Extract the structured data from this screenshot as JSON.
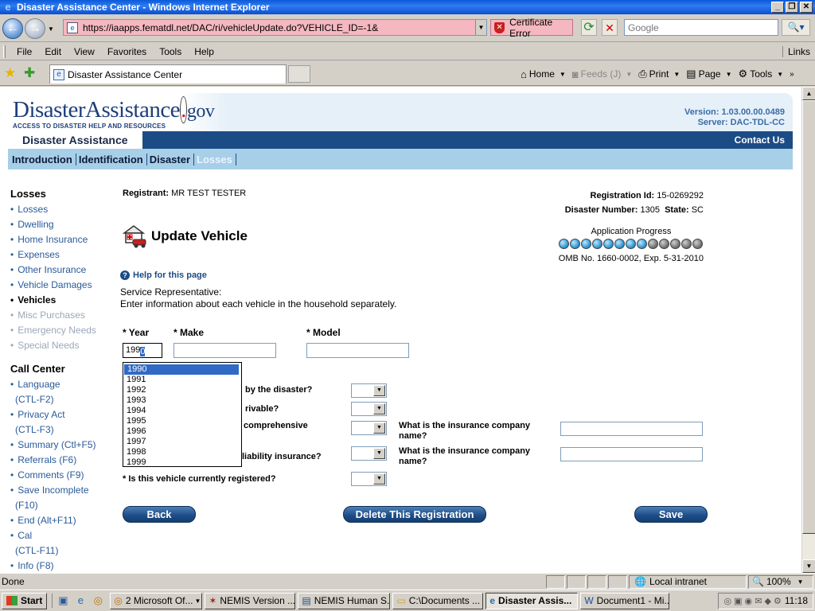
{
  "window": {
    "title": "Disaster Assistance Center - Windows Internet Explorer"
  },
  "address": {
    "url": "https://iaapps.fematdl.net/DAC/ri/vehicleUpdate.do?VEHICLE_ID=-1&",
    "cert_error": "Certificate Error",
    "search_placeholder": "Google"
  },
  "menu": {
    "items": [
      "File",
      "Edit",
      "View",
      "Favorites",
      "Tools",
      "Help"
    ],
    "links": "Links"
  },
  "tabbar": {
    "tab_title": "Disaster Assistance Center",
    "home": "Home",
    "feeds": "Feeds (J)",
    "print": "Print",
    "page": "Page",
    "tools": "Tools"
  },
  "site": {
    "logo_main": "DisasterAssistance",
    "logo_gov": "gov",
    "logo_tagline": "ACCESS TO DISASTER HELP AND RESOURCES",
    "version": "Version: 1.03.00.00.0489",
    "server": "Server: DAC-TDL-CC",
    "nav_tab": "Disaster Assistance",
    "contact": "Contact Us",
    "steps": [
      "Introduction",
      "Identification",
      "Disaster",
      "Losses"
    ]
  },
  "leftnav": {
    "losses_heading": "Losses",
    "losses_items": [
      {
        "label": "Losses",
        "state": "link"
      },
      {
        "label": "Dwelling",
        "state": "link"
      },
      {
        "label": "Home Insurance",
        "state": "link"
      },
      {
        "label": "Expenses",
        "state": "link"
      },
      {
        "label": "Other Insurance",
        "state": "link"
      },
      {
        "label": "Vehicle Damages",
        "state": "link"
      },
      {
        "label": "Vehicles",
        "state": "current"
      },
      {
        "label": "Misc Purchases",
        "state": "disabled"
      },
      {
        "label": "Emergency Needs",
        "state": "disabled"
      },
      {
        "label": "Special Needs",
        "state": "disabled"
      }
    ],
    "call_heading": "Call Center",
    "call_items": [
      {
        "label": "Language",
        "sub": "(CTL-F2)"
      },
      {
        "label": "Privacy Act",
        "sub": "(CTL-F3)"
      },
      {
        "label": "Summary (Ctl+F5)",
        "sub": ""
      },
      {
        "label": "Referrals (F6)",
        "sub": ""
      },
      {
        "label": "Comments (F9)",
        "sub": ""
      },
      {
        "label": "Save Incomplete",
        "sub": "(F10)"
      },
      {
        "label": "End (Alt+F11)",
        "sub": ""
      },
      {
        "label": "Cal",
        "sub": "(CTL-F11)"
      },
      {
        "label": "Info (F8)",
        "sub": ""
      }
    ]
  },
  "main": {
    "registrant_label": "Registrant:",
    "registrant_value": "MR TEST TESTER",
    "reg_id_label": "Registration Id:",
    "reg_id_value": "15-0269292",
    "disaster_label": "Disaster Number:",
    "disaster_value": "1305",
    "state_label": "State:",
    "state_value": "SC",
    "title": "Update Vehicle",
    "progress_label": "Application Progress",
    "progress_completed": 8,
    "progress_total": 13,
    "progress_colors": {
      "done": "#1f8fd0",
      "todo": "#6a6a6a"
    },
    "omb": "OMB No. 1660-0002, Exp. 5-31-2010",
    "help_link": "Help for this page",
    "svc_rep": "Service Representative:",
    "instruction": "Enter information about each vehicle in the household separately.",
    "year_label": "* Year",
    "make_label": "* Make",
    "model_label": "* Model",
    "year_value": "199",
    "year_value_selected": "0",
    "year_options": [
      "1990",
      "1991",
      "1992",
      "1993",
      "1994",
      "1995",
      "1996",
      "1997",
      "1998",
      "1999"
    ],
    "q1": "by the disaster?",
    "q2": "rivable?",
    "q3": "comprehensive",
    "q4": "liability insurance?",
    "q5": "* Is this vehicle currently registered?",
    "ins_q": "What is the insurance company name?",
    "back": "Back",
    "delete": "Delete This Registration",
    "save": "Save"
  },
  "status": {
    "text": "Done",
    "zone": "Local intranet",
    "zoom": "100%"
  },
  "taskbar": {
    "start": "Start",
    "tasks": [
      "2 Microsoft Of...",
      "NEMIS Version ...",
      "NEMIS Human S...",
      "C:\\Documents ...",
      "Disaster Assis...",
      "Document1 - Mi..."
    ],
    "active_task": 4,
    "clock": "11:18"
  }
}
